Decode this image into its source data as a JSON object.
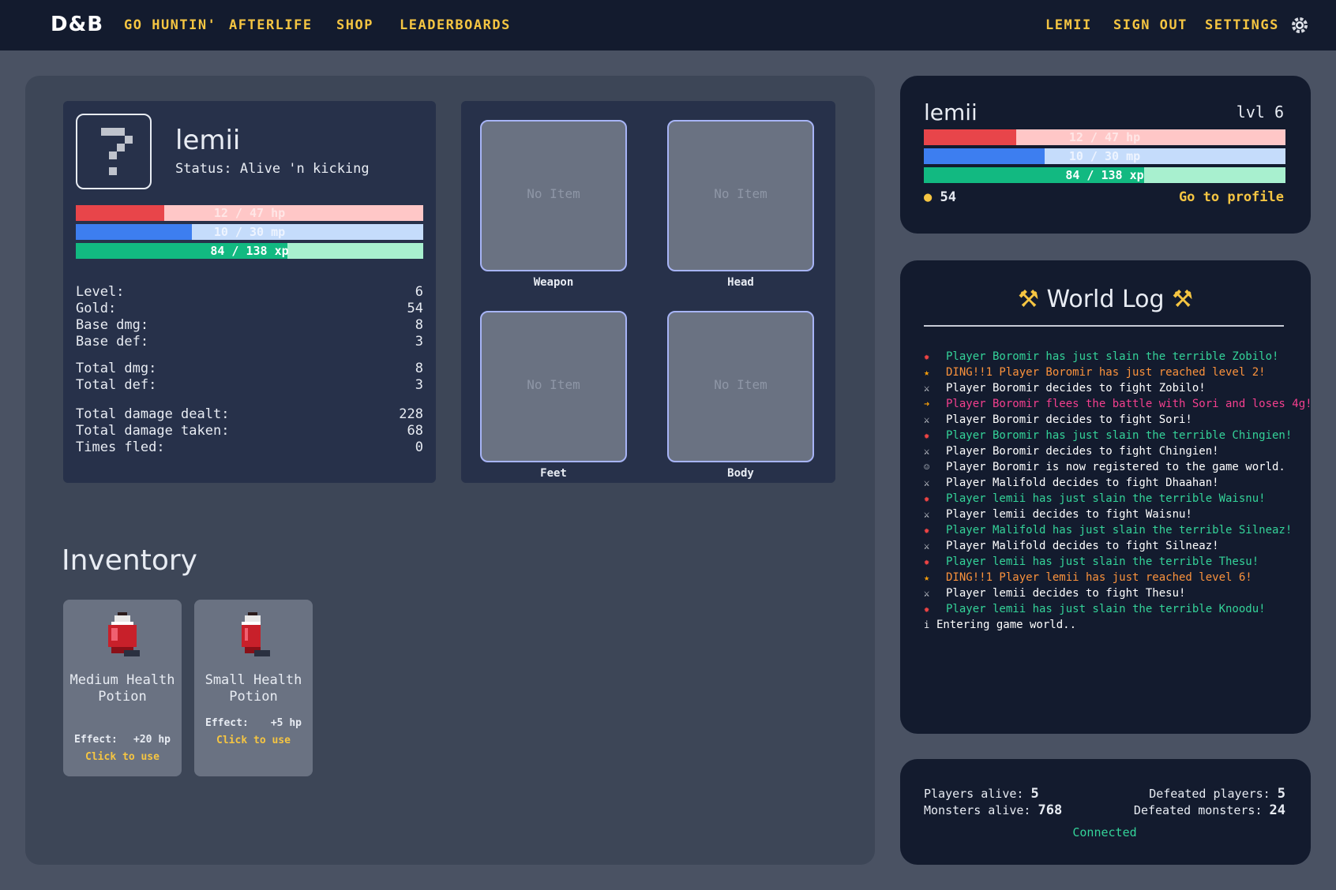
{
  "nav": {
    "logo": "D&B",
    "links": [
      "GO HUNTIN'",
      "AFTERLIFE",
      "SHOP",
      "LEADERBOARDS"
    ],
    "right": [
      "LEMII",
      "SIGN OUT",
      "SETTINGS"
    ],
    "settings_icon": "gear-icon"
  },
  "character": {
    "avatar_glyph": "?",
    "name": "lemii",
    "status": "Status: Alive 'n kicking",
    "hp_text": "12 / 47 hp",
    "hp_fraction": 0.255,
    "mp_text": "10 / 30 mp",
    "mp_fraction": 0.333,
    "xp_text": "84 / 138 xp",
    "xp_fraction": 0.609,
    "stats_1": [
      {
        "label": "Level:",
        "value": "6"
      },
      {
        "label": "Gold:",
        "value": "54"
      },
      {
        "label": "Base dmg:",
        "value": "8"
      },
      {
        "label": "Base def:",
        "value": "3"
      }
    ],
    "stats_2": [
      {
        "label": "Total dmg:",
        "value": "8"
      },
      {
        "label": "Total def:",
        "value": "3"
      }
    ],
    "stats_3": [
      {
        "label": "Total damage dealt:",
        "value": "228"
      },
      {
        "label": "Total damage taken:",
        "value": "68"
      },
      {
        "label": "Times fled:",
        "value": "0"
      }
    ]
  },
  "equipment": {
    "empty_text": "No Item",
    "slots": [
      "Weapon",
      "Head",
      "Feet",
      "Body"
    ]
  },
  "inventory": {
    "title": "Inventory",
    "items": [
      {
        "name": "Medium Health Potion",
        "effect_label": "Effect:",
        "effect_value": "+20 hp",
        "use": "Click to use",
        "icon": "medium-potion-icon"
      },
      {
        "name": "Small Health Potion",
        "effect_label": "Effect:",
        "effect_value": "+5 hp",
        "use": "Click to use",
        "icon": "small-potion-icon"
      }
    ]
  },
  "summary": {
    "name": "lemii",
    "level": "lvl 6",
    "hp_text": "12 / 47 hp",
    "mp_text": "10 / 30 mp",
    "xp_text": "84 / 138 xp",
    "gold": "54",
    "profile_link": "Go to profile"
  },
  "world_log": {
    "title": "World Log",
    "entries": [
      {
        "text": "Player Boromir has just slain the terrible Zobilo!",
        "type": "slain"
      },
      {
        "text": "DING!!1 Player Boromir has just reached level 2!",
        "type": "level"
      },
      {
        "text": "Player Boromir decides to fight Zobilo!",
        "type": "fight"
      },
      {
        "text": "Player Boromir flees the battle with Sori and loses 4g!",
        "type": "flee"
      },
      {
        "text": "Player Boromir decides to fight Sori!",
        "type": "fight"
      },
      {
        "text": "Player Boromir has just slain the terrible Chingien!",
        "type": "slain"
      },
      {
        "text": "Player Boromir decides to fight Chingien!",
        "type": "fight"
      },
      {
        "text": "Player Boromir is now registered to the game world.",
        "type": "register"
      },
      {
        "text": "Player Malifold decides to fight Dhaahan!",
        "type": "fight"
      },
      {
        "text": "Player lemii has just slain the terrible Waisnu!",
        "type": "slain"
      },
      {
        "text": "Player lemii decides to fight Waisnu!",
        "type": "fight"
      },
      {
        "text": "Player Malifold has just slain the terrible Silneaz!",
        "type": "slain"
      },
      {
        "text": "Player Malifold decides to fight Silneaz!",
        "type": "fight"
      },
      {
        "text": "Player lemii has just slain the terrible Thesu!",
        "type": "slain"
      },
      {
        "text": "DING!!1 Player lemii has just reached level 6!",
        "type": "level"
      },
      {
        "text": "Player lemii decides to fight Thesu!",
        "type": "fight"
      },
      {
        "text": "Player lemii has just slain the terrible Knoodu!",
        "type": "slain"
      },
      {
        "text": "Entering game world..",
        "type": "info"
      }
    ]
  },
  "counters": {
    "players_alive_label": "Players alive:",
    "players_alive": "5",
    "monsters_alive_label": "Monsters alive:",
    "monsters_alive": "768",
    "defeated_players_label": "Defeated players:",
    "defeated_players": "5",
    "defeated_monsters_label": "Defeated monsters:",
    "defeated_monsters": "24",
    "connection": "Connected"
  },
  "colors": {
    "background": "#4a5263",
    "topbar": "#131b2e",
    "accent_yellow": "#f5c542",
    "hp_fill": "#e8454a",
    "hp_track": "#ffc7c7",
    "mp_fill": "#3d7ef0",
    "mp_track": "#c5dcfb",
    "xp_fill": "#12b981",
    "xp_track": "#a8f0cf",
    "log_slain": "#34d399",
    "log_level": "#fb923c",
    "log_flee": "#f43f8e",
    "log_default": "#ffffff"
  }
}
